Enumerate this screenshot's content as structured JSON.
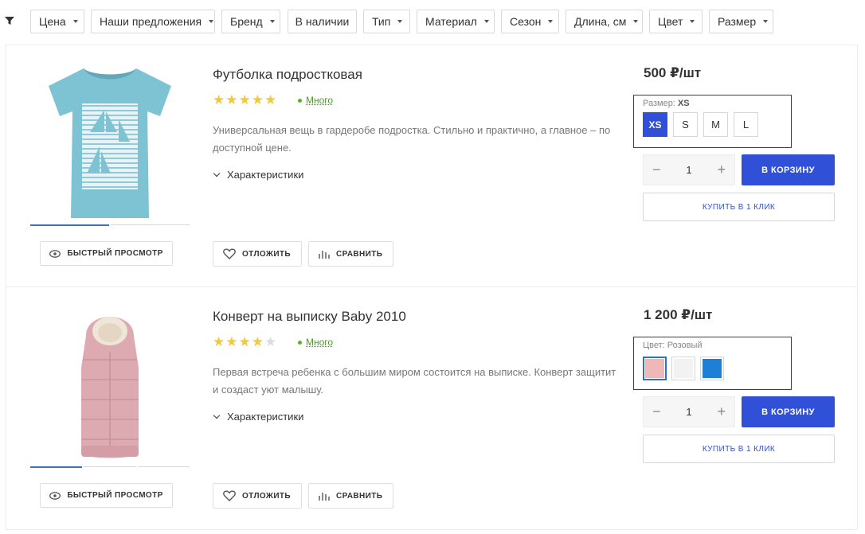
{
  "filters": [
    {
      "label": "Цена"
    },
    {
      "label": "Наши предложения"
    },
    {
      "label": "Бренд"
    },
    {
      "label": "В наличии",
      "no_caret": true
    },
    {
      "label": "Тип"
    },
    {
      "label": "Материал"
    },
    {
      "label": "Сезон"
    },
    {
      "label": "Длина, см"
    },
    {
      "label": "Цвет"
    },
    {
      "label": "Размер"
    }
  ],
  "common": {
    "quick_view": "БЫСТРЫЙ ПРОСМОТР",
    "postpone": "ОТЛОЖИТЬ",
    "compare": "СРАВНИТЬ",
    "to_cart": "В КОРЗИНУ",
    "one_click": "КУПИТЬ В 1 КЛИК",
    "specs": "Характеристики"
  },
  "products": [
    {
      "title": "Футболка подростковая",
      "rating": 5,
      "stock": "Много",
      "description": "Универсальная вещь в гардеробе подростка. Стильно и практично, а главное – по доступной цене.",
      "price": "500 ₽/шт",
      "qty": "1",
      "option_label": "Размер:",
      "option_value": "XS",
      "sizes": [
        "XS",
        "S",
        "M",
        "L"
      ],
      "selected_size": "XS",
      "slider_count": 2,
      "slider_active": 0
    },
    {
      "title": "Конверт на выписку Baby 2010",
      "rating": 4,
      "stock": "Много",
      "description": "Первая встреча ребенка с большим миром состоится на выписке. Конверт защитит и создаст уют малышу.",
      "price": "1 200 ₽/шт",
      "qty": "1",
      "option_label": "Цвет:",
      "option_value": "Розовый",
      "colors": [
        "#eeb8b8",
        "#f2f2f2",
        "#1e7fd6"
      ],
      "selected_color": 0,
      "slider_count": 3,
      "slider_active": 0
    }
  ],
  "colors": {
    "accent": "#3150d8",
    "highlight_border": "#a31515",
    "star": "#f1c93b",
    "stock": "#4d9a2b"
  }
}
